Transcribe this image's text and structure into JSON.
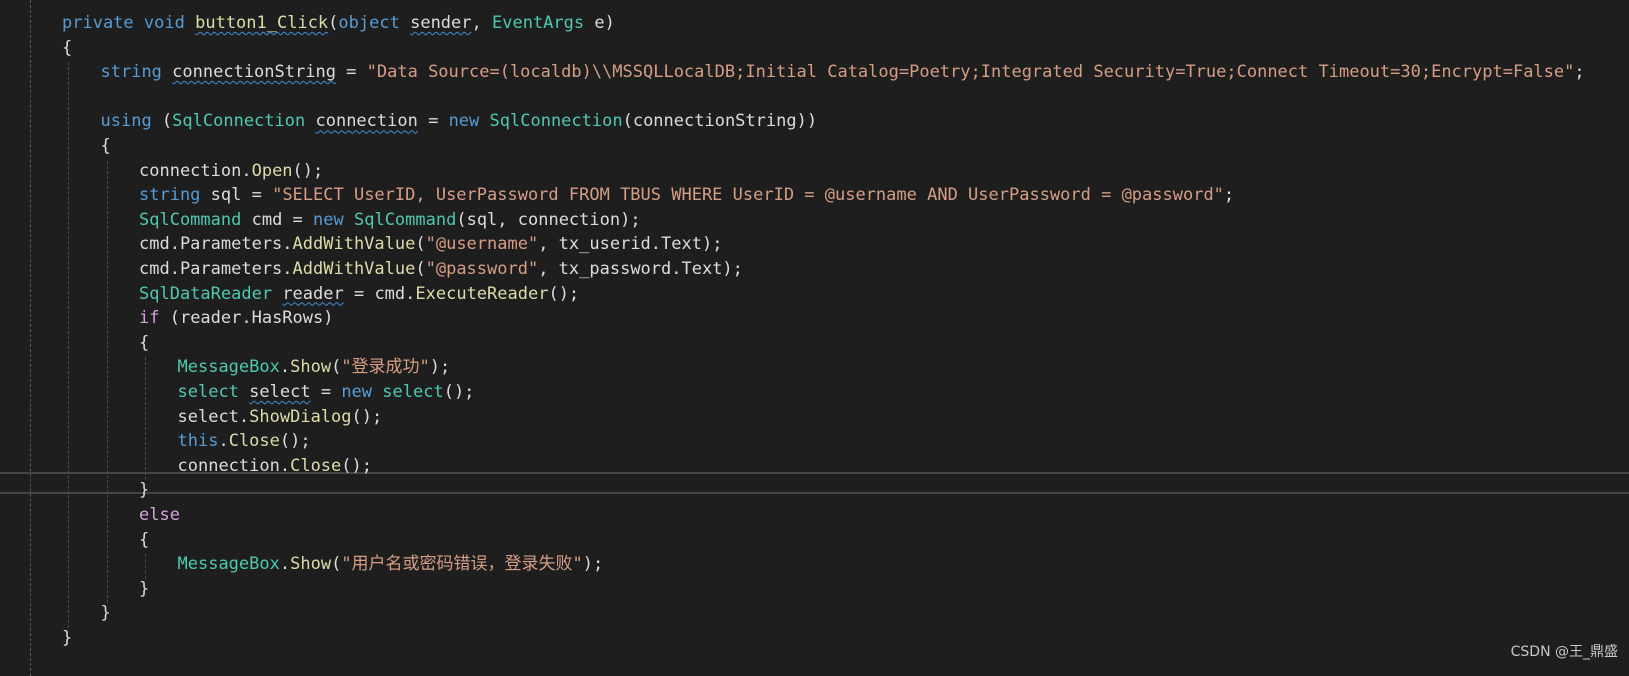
{
  "editor": {
    "lines": [
      [
        {
          "t": "private",
          "c": "kw"
        },
        {
          "t": " "
        },
        {
          "t": "void",
          "c": "kw"
        },
        {
          "t": " "
        },
        {
          "t": "button1_Click",
          "c": "fn",
          "s": 1
        },
        {
          "t": "("
        },
        {
          "t": "object",
          "c": "kw"
        },
        {
          "t": " "
        },
        {
          "t": "sender",
          "s": 1
        },
        {
          "t": ", "
        },
        {
          "t": "EventArgs",
          "c": "ty"
        },
        {
          "t": " e)"
        }
      ],
      [
        {
          "t": "{"
        }
      ],
      [
        {
          "t": "string",
          "c": "kw"
        },
        {
          "t": " "
        },
        {
          "t": "connectionString",
          "s": 1
        },
        {
          "t": " = "
        },
        {
          "t": "\"Data Source=(localdb)\\\\MSSQLLocalDB;Initial Catalog=Poetry;Integrated Security=True;Connect Timeout=30;Encrypt=False\"",
          "c": "str"
        },
        {
          "t": ";"
        }
      ],
      [],
      [
        {
          "t": "using",
          "c": "kw"
        },
        {
          "t": " ("
        },
        {
          "t": "SqlConnection",
          "c": "ty"
        },
        {
          "t": " "
        },
        {
          "t": "connection",
          "s": 1
        },
        {
          "t": " = "
        },
        {
          "t": "new",
          "c": "kw"
        },
        {
          "t": " "
        },
        {
          "t": "SqlConnection",
          "c": "ty"
        },
        {
          "t": "(connectionString))"
        }
      ],
      [
        {
          "t": "{"
        }
      ],
      [
        {
          "t": "connection."
        },
        {
          "t": "Open",
          "c": "fn"
        },
        {
          "t": "();"
        }
      ],
      [
        {
          "t": "string",
          "c": "kw"
        },
        {
          "t": " sql = "
        },
        {
          "t": "\"SELECT UserID, UserPassword FROM TBUS WHERE UserID = @username AND UserPassword = @password\"",
          "c": "str"
        },
        {
          "t": ";"
        }
      ],
      [
        {
          "t": "SqlCommand",
          "c": "ty"
        },
        {
          "t": " cmd = "
        },
        {
          "t": "new",
          "c": "kw"
        },
        {
          "t": " "
        },
        {
          "t": "SqlCommand",
          "c": "ty"
        },
        {
          "t": "(sql, connection);"
        }
      ],
      [
        {
          "t": "cmd.Parameters."
        },
        {
          "t": "AddWithValue",
          "c": "fn"
        },
        {
          "t": "("
        },
        {
          "t": "\"@username\"",
          "c": "str"
        },
        {
          "t": ", tx_userid.Text);"
        }
      ],
      [
        {
          "t": "cmd.Parameters."
        },
        {
          "t": "AddWithValue",
          "c": "fn"
        },
        {
          "t": "("
        },
        {
          "t": "\"@password\"",
          "c": "str"
        },
        {
          "t": ", tx_password.Text);"
        }
      ],
      [
        {
          "t": "SqlDataReader",
          "c": "ty"
        },
        {
          "t": " "
        },
        {
          "t": "reader",
          "s": 1
        },
        {
          "t": " = cmd."
        },
        {
          "t": "ExecuteReader",
          "c": "fn"
        },
        {
          "t": "();"
        }
      ],
      [
        {
          "t": "if",
          "c": "ctl"
        },
        {
          "t": " (reader.HasRows)"
        }
      ],
      [
        {
          "t": "{"
        }
      ],
      [
        {
          "t": "MessageBox",
          "c": "ty"
        },
        {
          "t": "."
        },
        {
          "t": "Show",
          "c": "fn"
        },
        {
          "t": "("
        },
        {
          "t": "\"登录成功\"",
          "c": "str"
        },
        {
          "t": ");"
        }
      ],
      [
        {
          "t": "select",
          "c": "ty"
        },
        {
          "t": " "
        },
        {
          "t": "select",
          "s": 1
        },
        {
          "t": " = "
        },
        {
          "t": "new",
          "c": "kw"
        },
        {
          "t": " "
        },
        {
          "t": "select",
          "c": "ty"
        },
        {
          "t": "();"
        }
      ],
      [
        {
          "t": "select."
        },
        {
          "t": "ShowDialog",
          "c": "fn"
        },
        {
          "t": "();"
        }
      ],
      [
        {
          "t": "this",
          "c": "kw"
        },
        {
          "t": "."
        },
        {
          "t": "Close",
          "c": "fn"
        },
        {
          "t": "();"
        }
      ],
      [
        {
          "t": "connection."
        },
        {
          "t": "Close",
          "c": "fn"
        },
        {
          "t": "();"
        }
      ],
      [
        {
          "t": "}"
        }
      ],
      [
        {
          "t": "else",
          "c": "ctl"
        }
      ],
      [
        {
          "t": "{"
        }
      ],
      [
        {
          "t": "MessageBox",
          "c": "ty"
        },
        {
          "t": "."
        },
        {
          "t": "Show",
          "c": "fn"
        },
        {
          "t": "("
        },
        {
          "t": "\"用户名或密码错误，登录失败\"",
          "c": "str"
        },
        {
          "t": ");"
        }
      ],
      [
        {
          "t": "}"
        }
      ],
      [
        {
          "t": "}"
        }
      ],
      [
        {
          "t": "}"
        }
      ]
    ]
  },
  "watermark": "CSDN @王_鼎盛",
  "colors": {
    "background": "#1e1e1e",
    "keyword": "#569cd6",
    "type": "#4ec9b0",
    "string": "#d69d85",
    "method": "#dcdcaa",
    "control": "#d8a0df",
    "text": "#dcdcdc",
    "squiggle": "#3f8fd8"
  }
}
